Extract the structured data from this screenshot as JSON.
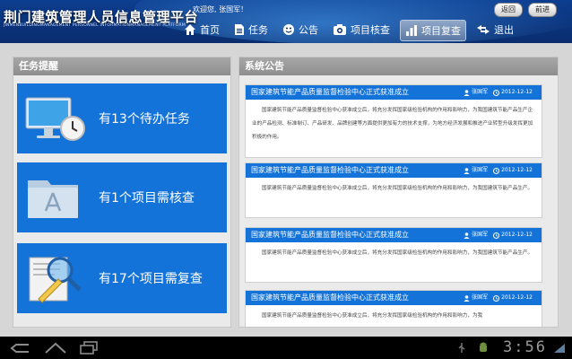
{
  "header": {
    "title": "荆门建筑管理人员信息管理平台",
    "subtitle": "JINMENBUILDINGMANAGEMENT PERSONNEL INFORMATIONMANAGEMENT PLATFORM",
    "welcome": "欢迎您, 张国军！",
    "back_label": "返回",
    "forward_label": "前进"
  },
  "nav": [
    {
      "label": "首页",
      "icon": "home-icon"
    },
    {
      "label": "任务",
      "icon": "document-icon"
    },
    {
      "label": "公告",
      "icon": "smiley-icon"
    },
    {
      "label": "项目核查",
      "icon": "camera-icon"
    },
    {
      "label": "项目复查",
      "icon": "bar-chart-icon",
      "active": true
    },
    {
      "label": "退出",
      "icon": "exit-arrows-icon"
    }
  ],
  "tasks": {
    "title": "任务提醒",
    "items": [
      {
        "label": "有13个待办任务",
        "icon": "monitor-clock-icon"
      },
      {
        "label": "有1个项目需核查",
        "icon": "folder-icon"
      },
      {
        "label": "有17个项目需复查",
        "icon": "magnifier-pencil-icon"
      }
    ]
  },
  "notices": {
    "title": "系统公告",
    "items": [
      {
        "title": "国家建筑节能产品质量监督检验中心正式获准成立",
        "author": "张国军",
        "date": "2012-12-12",
        "body": "国家建筑节能产品质量监督检验中心获准成立后，将充分发挥国家级检验机构的作用和影响力，为我国建筑节能产品生产企业的产品检测、标准制订、产品研发、品牌创建等方面提供更加有力的技术支撑，为地方经济发展和推进产业转型升级发挥更加积极的作用。"
      },
      {
        "title": "国家建筑节能产品质量监督检验中心正式获准成立",
        "author": "张国军",
        "date": "2012-12-12",
        "body": "国家建筑节能产品质量监督检验中心获准成立后，将充分发挥国家级检验机构的作用和影响力，为我国建筑节能产品生产。"
      },
      {
        "title": "国家建筑节能产品质量监督检验中心正式获准成立",
        "author": "张国军",
        "date": "2012-12-12",
        "body": "国家建筑节能产品质量监督检验中心获准成立后，将充分发挥国家级检验机构的作用和影响力，为我国建筑节能产品生产。"
      },
      {
        "title": "国家建筑节能产品质量监督检验中心正式获准成立",
        "author": "张国军",
        "date": "2012-12-12",
        "body": "国家建筑节能产品质量监督检验中心获准成立后，将充分发挥国家级检验机构的作用和影响力，为我"
      }
    ]
  },
  "system": {
    "time": "3:56"
  }
}
